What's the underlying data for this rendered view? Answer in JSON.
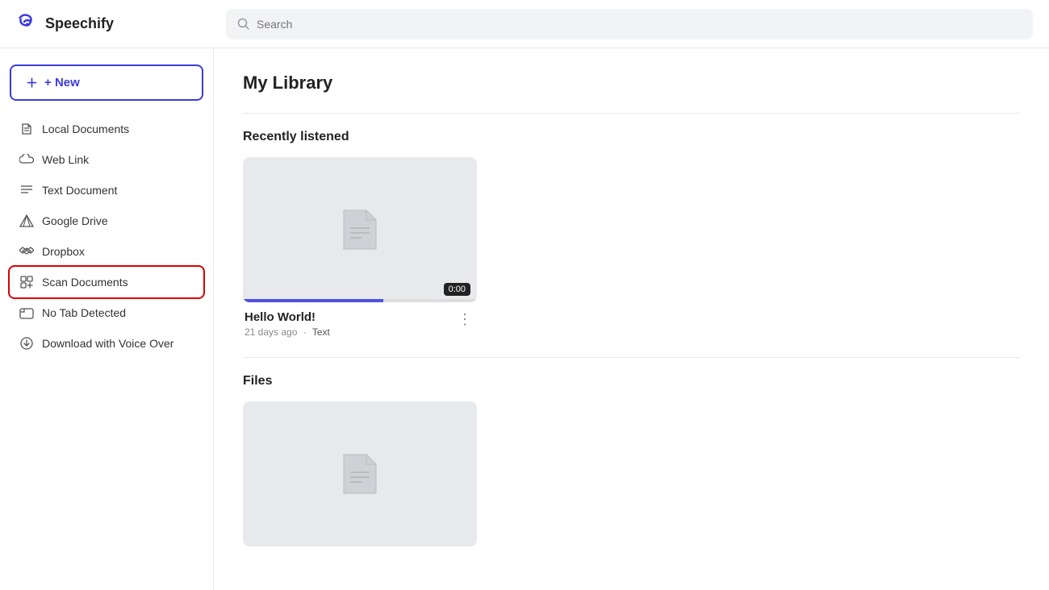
{
  "header": {
    "logo_text": "Speechify",
    "search_placeholder": "Search"
  },
  "sidebar": {
    "new_button_label": "+ New",
    "items": [
      {
        "id": "local-documents",
        "label": "Local Documents",
        "icon": "file-icon"
      },
      {
        "id": "web-link",
        "label": "Web Link",
        "icon": "cloud-icon"
      },
      {
        "id": "text-document",
        "label": "Text Document",
        "icon": "text-icon"
      },
      {
        "id": "google-drive",
        "label": "Google Drive",
        "icon": "drive-icon"
      },
      {
        "id": "dropbox",
        "label": "Dropbox",
        "icon": "dropbox-icon"
      },
      {
        "id": "scan-documents",
        "label": "Scan Documents",
        "icon": "scan-icon",
        "highlighted": true
      },
      {
        "id": "no-tab-detected",
        "label": "No Tab Detected",
        "icon": "tab-icon"
      },
      {
        "id": "download-voice-over",
        "label": "Download with Voice Over",
        "icon": "download-icon"
      }
    ]
  },
  "main": {
    "page_title": "My Library",
    "recently_listened_section": "Recently listened",
    "files_section": "Files",
    "cards": [
      {
        "id": "hello-world",
        "title": "Hello World!",
        "meta_time": "21 days ago",
        "meta_dot": "·",
        "meta_tag": "Text",
        "time_badge": "0:00",
        "progress_percent": 60
      }
    ]
  },
  "icons": {
    "search": "🔍",
    "plus": "+",
    "file": "📄",
    "cloud": "☁",
    "text": "≡",
    "drive": "△",
    "dropbox": "✦",
    "scan": "⊡",
    "tab": "▣",
    "download": "⬇",
    "more": "⋮",
    "doc_placeholder": "📄"
  }
}
